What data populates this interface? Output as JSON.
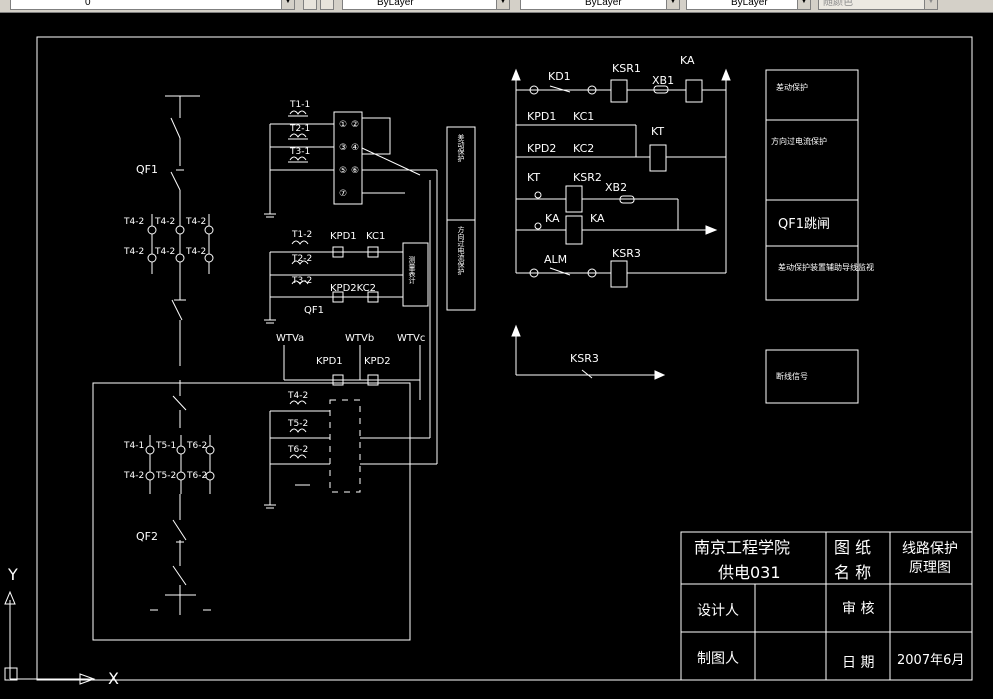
{
  "toolbar": {
    "layer_value": "0",
    "color_value": "ByLayer",
    "linetype_value": "ByLayer",
    "lineweight_value": "ByLayer",
    "plotstyle_value": "随颜色"
  },
  "colors": {
    "background": "#000000",
    "lines": "#ffffff",
    "toolbar": "#d4d0c8"
  },
  "ucs": {
    "y_label": "Y",
    "x_label": "X"
  },
  "diagram": {
    "left_labels": {
      "qf1": "QF1",
      "qf2": "QF2",
      "t4_top": "T4-2",
      "t4_top2": "T4-2",
      "t4_top3": "T4-2",
      "t4_mid": "T4-2",
      "t4_mid2": "T4-2",
      "t4_mid3": "T4-2",
      "t4_1": "T4-1",
      "t5_1": "T5-1",
      "t6_2": "T6-2",
      "t4_2b": "T4-2",
      "t5_2b": "T5-2",
      "t6_2b": "T6-2"
    },
    "middle_labels": {
      "t1_1": "T1-1",
      "t2_1": "T2-1",
      "t3_1": "T3-1",
      "t1_2": "T1-2",
      "t2_2": "T2-2",
      "t3_2": "T3-2",
      "kpd1": "KPD1",
      "kc1": "KC1",
      "kpd2kc2": "KPD2KC2",
      "qf1": "QF1",
      "wtva": "WTVa",
      "wtvb": "WTVb",
      "wtvc": "WTVc",
      "kpd1_b": "KPD1",
      "kpd2_b": "KPD2",
      "t4_2": "T4-2",
      "t5_2": "T5-2",
      "t6_2": "T6-2",
      "n1": "①",
      "n2": "②",
      "n3": "③",
      "n4": "④",
      "n5": "⑤",
      "n6": "⑥",
      "n7": "⑦",
      "box_text_1": "测量表计",
      "relay_box_1": "差动保护",
      "relay_box_2": "方向过电流保护"
    },
    "right_labels": {
      "kd1": "KD1",
      "ksr1": "KSR1",
      "xb1": "XB1",
      "ka": "KA",
      "kpd1": "KPD1",
      "kc1": "KC1",
      "kt": "KT",
      "kpd2": "KPD2",
      "kc2": "KC2",
      "kt2": "KT",
      "ksr2": "KSR2",
      "xb2": "XB2",
      "ka2": "KA",
      "ka3": "KA",
      "alm": "ALM",
      "ksr3": "KSR3",
      "ksr3_b": "KSR3"
    },
    "side_boxes": [
      {
        "text": "差动保护"
      },
      {
        "text": "方向过电流保护"
      },
      {
        "text": "QF1跳闸"
      },
      {
        "text": "差动保护装置辅助导线监视"
      },
      {
        "text": "断线信号"
      }
    ]
  },
  "title_block": {
    "school": "南京工程学院",
    "class": "供电031",
    "drawing_label_1": "图 纸",
    "drawing_label_2": "名 称",
    "drawing_name_1": "线路保护",
    "drawing_name_2": "原理图",
    "designer_label": "设计人",
    "reviewer_label": "审 核",
    "drafter_label": "制图人",
    "date_label": "日 期",
    "date_value": "2007年6月"
  }
}
